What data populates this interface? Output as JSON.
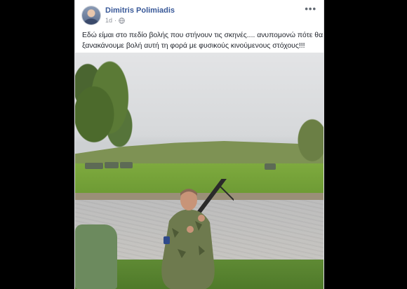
{
  "post": {
    "author": "Dimitris Polimiadis",
    "timestamp": "1d",
    "text_line1": "Εδώ είμαι στο πεδίο βολής που στήνουν τις σκηνές.... ανυπομονώ πότε θα",
    "text_line2": "ξανακάνουμε βολή αυτή τη φορά με φυσικούς κινούμενους στόχους!!!",
    "more_label": "•••"
  },
  "icons": {
    "audience": "globe-icon",
    "options": "more-options-icon"
  },
  "colors": {
    "author_link": "#385898",
    "meta_text": "#90949c",
    "body_text": "#1d2129",
    "background": "#000000",
    "card": "#ffffff"
  }
}
